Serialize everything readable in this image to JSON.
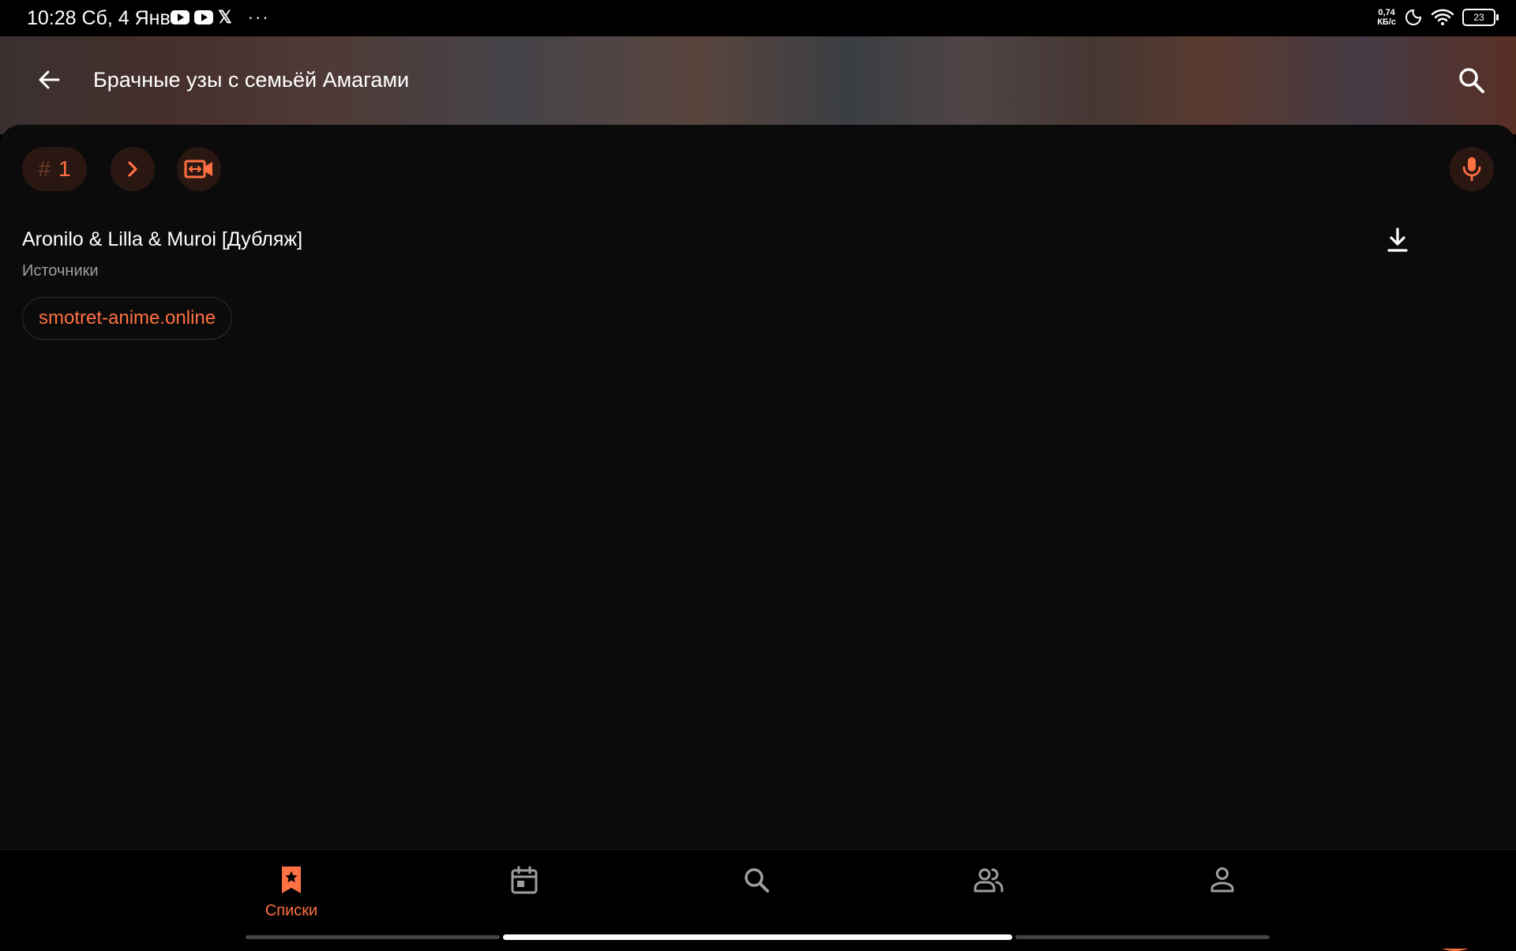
{
  "status_bar": {
    "time_date": "10:28 Сб, 4 Янв",
    "overflow": "···",
    "x_app": "𝕏",
    "net_speed_value": "0,74",
    "net_speed_unit": "КБ/с",
    "battery": "23"
  },
  "header": {
    "title": "Брачные узы с семьёй Амагами"
  },
  "episode": {
    "hash": "#",
    "number": "1"
  },
  "translation": {
    "title": "Aronilo & Lilla & Muroi [Дубляж]",
    "sources_label": "Источники",
    "source": "smotret-anime.online"
  },
  "nav": {
    "lists_label": "Списки"
  },
  "colors": {
    "accent": "#ff7043",
    "chip_bg": "#2a1712",
    "panel_bg": "#0b0b0b"
  },
  "icons": [
    "arrow-back-icon",
    "search-icon",
    "chevron-right-icon",
    "video-swap-icon",
    "mic-icon",
    "download-icon",
    "chat-icon",
    "bookmark-star-icon",
    "calendar-icon",
    "people-icon",
    "person-icon"
  ]
}
